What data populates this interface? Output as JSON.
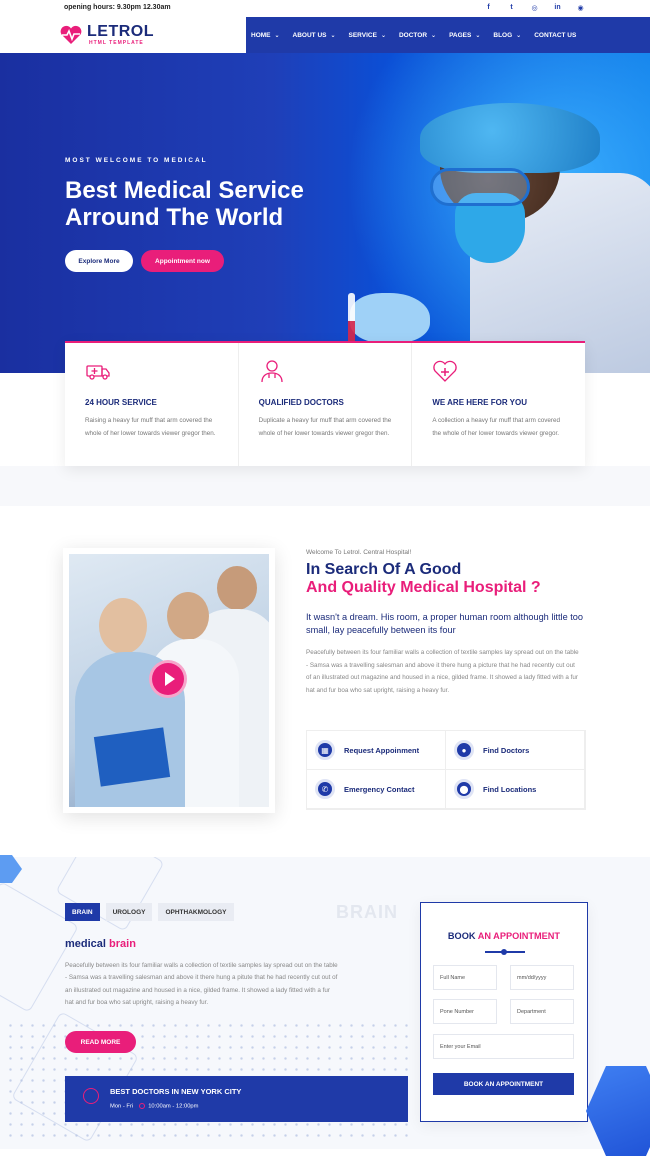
{
  "topbar": {
    "hours": "opening hours: 9.30pm 12.30am"
  },
  "social_icons": [
    "facebook-icon",
    "twitter-icon",
    "dribbble-icon",
    "linkedin-icon",
    "instagram-icon"
  ],
  "social_glyphs": [
    "f",
    "t",
    "◎",
    "in",
    "◉"
  ],
  "brand": {
    "name": "LETROL",
    "tagline": "HTML TEMPLATE"
  },
  "nav": {
    "items": [
      {
        "label": "HOME",
        "has_dropdown": true
      },
      {
        "label": "ABOUT US",
        "has_dropdown": true
      },
      {
        "label": "SERVICE",
        "has_dropdown": true
      },
      {
        "label": "DOCTOR",
        "has_dropdown": true
      },
      {
        "label": "PAGES",
        "has_dropdown": true
      },
      {
        "label": "BLOG",
        "has_dropdown": true
      },
      {
        "label": "CONTACT US",
        "has_dropdown": false
      }
    ],
    "chevron": "⌄"
  },
  "hero": {
    "kicker": "MOST WELCOME TO MEDICAL",
    "title": "Best Medical Service Arround The World",
    "btn_explore": "Explore More",
    "btn_appointment": "Appointment now"
  },
  "features": [
    {
      "icon": "ambulance-icon",
      "title": "24 HOUR SERVICE",
      "text": "Raising a heavy fur muff that arm covered the whole of her lower towards viewer gregor then."
    },
    {
      "icon": "doctor-icon",
      "title": "QUALIFIED DOCTORS",
      "text": "Duplicate a heavy fur muff that arm covered the whole of her lower towards viewer gregor then."
    },
    {
      "icon": "heart-plus-icon",
      "title": "WE ARE HERE FOR YOU",
      "text": "A collection a heavy fur muff that arm covered the whole of her lower towards viewer gregor."
    }
  ],
  "about": {
    "small": "Welcome To Letrol. Central Hospital!",
    "title_line1": "In Search Of A Good",
    "title_line2": "And Quality Medical Hospital ?",
    "lead": "It wasn't a dream. His room, a proper human room although little too small, lay peacefully between its four",
    "paragraph": "Peacefully between its four familiar walls a collection of textile samples lay spread out on the table - Samsa was a travelling salesman and above it there hung a picture that he had recently cut out of an illustrated out magazine and housed in a nice, gilded frame. It showed a lady fitted with a fur hat and fur boa who sat upright, raising a heavy fur.",
    "links": [
      {
        "icon": "calendar-icon",
        "glyph": "▦",
        "label": "Request Appoinment"
      },
      {
        "icon": "user-icon",
        "glyph": "●",
        "label": "Find Doctors"
      },
      {
        "icon": "phone-icon",
        "glyph": "✆",
        "label": "Emergency Contact"
      },
      {
        "icon": "location-pin-icon",
        "glyph": "⬤",
        "label": "Find Locations"
      }
    ]
  },
  "departments": {
    "tabs": [
      "BRAIN",
      "UROLOGY",
      "OPHTHAKMOLOGY"
    ],
    "active_tab": "BRAIN",
    "watermark": "BRAIN",
    "title_plain": "medical",
    "title_accent": "brain",
    "text": "Peacefully between its four familiar walls a collection of textile samples lay spread out on the table - Samsa was a travelling salesman and above it there hung a pitute that he had recently cut out of an illustrated out magazine and housed in a nice, gilded frame. It showed a lady fitted with a fur hat and fur boa who sat upright, raising a heavy fur.",
    "read_more": "READ MORE",
    "best": {
      "title": "BEST DOCTORS IN NEW YORK CITY",
      "days": "Mon - Fri",
      "time": "10:00am - 12:00pm"
    }
  },
  "booking": {
    "title_plain": "BOOK",
    "title_accent": "AN APPOINTMENT",
    "fields": {
      "full_name": "Full Name",
      "date": "mm/dd/yyyy",
      "phone": "Pone Number",
      "department": "Department",
      "email": "Enter your Email"
    },
    "submit": "BOOK AN APPOINTMENT"
  },
  "colors": {
    "primary": "#1f3aa8",
    "accent": "#e91e7a",
    "heading": "#1b2b7a"
  }
}
